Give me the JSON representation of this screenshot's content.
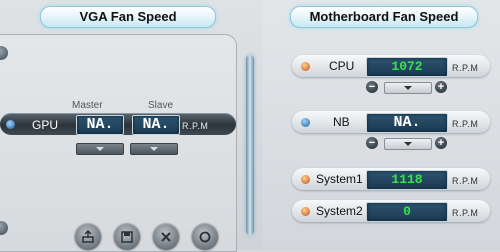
{
  "vga": {
    "title": "VGA Fan Speed",
    "master_header": "Master",
    "slave_header": "Slave",
    "gpu_label": "GPU",
    "master_value": "NA.",
    "slave_value": "NA.",
    "unit": "R.P.M"
  },
  "motherboard": {
    "title": "Motherboard Fan Speed",
    "rows": [
      {
        "label": "CPU",
        "value": "1072",
        "unit": "R.P.M"
      },
      {
        "label": "NB",
        "value": "NA.",
        "unit": "R.P.M"
      },
      {
        "label": "System1",
        "value": "1118",
        "unit": "R.P.M"
      },
      {
        "label": "System2",
        "value": "0",
        "unit": "R.P.M"
      }
    ],
    "minus": "−",
    "plus": "+"
  }
}
